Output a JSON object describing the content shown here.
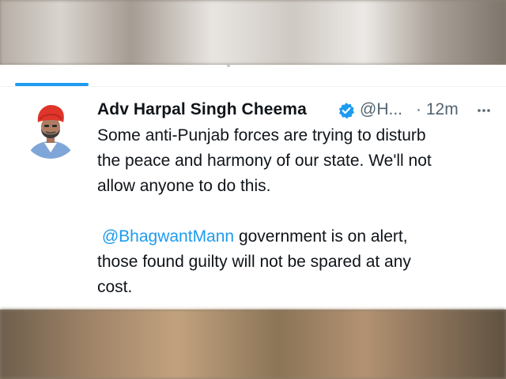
{
  "tweet": {
    "author_name": "Adv Harpal Singh Cheema",
    "handle": "@H...",
    "separator": "·",
    "time": "12m",
    "body_lines": [
      "Some anti-Punjab forces are trying to disturb",
      "the peace and harmony of our state. We'll not",
      "allow anyone to do this."
    ],
    "mention": "@BhagwantMann",
    "mention_rest": " government is on alert,",
    "body_lines_2": [
      "those found guilty will not be spared at any",
      "cost."
    ]
  },
  "icons": {
    "verified": "verified-badge-icon",
    "more": "more-options-icon"
  },
  "colors": {
    "accent": "#1d9bf0",
    "text": "#0f1419",
    "secondary_text": "#536471"
  }
}
